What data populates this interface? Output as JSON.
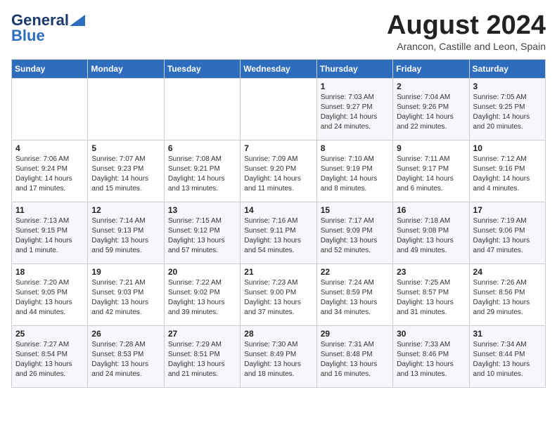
{
  "logo": {
    "line1": "General",
    "line2": "Blue"
  },
  "title": "August 2024",
  "subtitle": "Arancon, Castille and Leon, Spain",
  "headers": [
    "Sunday",
    "Monday",
    "Tuesday",
    "Wednesday",
    "Thursday",
    "Friday",
    "Saturday"
  ],
  "weeks": [
    [
      {
        "day": "",
        "info": ""
      },
      {
        "day": "",
        "info": ""
      },
      {
        "day": "",
        "info": ""
      },
      {
        "day": "",
        "info": ""
      },
      {
        "day": "1",
        "info": "Sunrise: 7:03 AM\nSunset: 9:27 PM\nDaylight: 14 hours\nand 24 minutes."
      },
      {
        "day": "2",
        "info": "Sunrise: 7:04 AM\nSunset: 9:26 PM\nDaylight: 14 hours\nand 22 minutes."
      },
      {
        "day": "3",
        "info": "Sunrise: 7:05 AM\nSunset: 9:25 PM\nDaylight: 14 hours\nand 20 minutes."
      }
    ],
    [
      {
        "day": "4",
        "info": "Sunrise: 7:06 AM\nSunset: 9:24 PM\nDaylight: 14 hours\nand 17 minutes."
      },
      {
        "day": "5",
        "info": "Sunrise: 7:07 AM\nSunset: 9:23 PM\nDaylight: 14 hours\nand 15 minutes."
      },
      {
        "day": "6",
        "info": "Sunrise: 7:08 AM\nSunset: 9:21 PM\nDaylight: 14 hours\nand 13 minutes."
      },
      {
        "day": "7",
        "info": "Sunrise: 7:09 AM\nSunset: 9:20 PM\nDaylight: 14 hours\nand 11 minutes."
      },
      {
        "day": "8",
        "info": "Sunrise: 7:10 AM\nSunset: 9:19 PM\nDaylight: 14 hours\nand 8 minutes."
      },
      {
        "day": "9",
        "info": "Sunrise: 7:11 AM\nSunset: 9:17 PM\nDaylight: 14 hours\nand 6 minutes."
      },
      {
        "day": "10",
        "info": "Sunrise: 7:12 AM\nSunset: 9:16 PM\nDaylight: 14 hours\nand 4 minutes."
      }
    ],
    [
      {
        "day": "11",
        "info": "Sunrise: 7:13 AM\nSunset: 9:15 PM\nDaylight: 14 hours\nand 1 minute."
      },
      {
        "day": "12",
        "info": "Sunrise: 7:14 AM\nSunset: 9:13 PM\nDaylight: 13 hours\nand 59 minutes."
      },
      {
        "day": "13",
        "info": "Sunrise: 7:15 AM\nSunset: 9:12 PM\nDaylight: 13 hours\nand 57 minutes."
      },
      {
        "day": "14",
        "info": "Sunrise: 7:16 AM\nSunset: 9:11 PM\nDaylight: 13 hours\nand 54 minutes."
      },
      {
        "day": "15",
        "info": "Sunrise: 7:17 AM\nSunset: 9:09 PM\nDaylight: 13 hours\nand 52 minutes."
      },
      {
        "day": "16",
        "info": "Sunrise: 7:18 AM\nSunset: 9:08 PM\nDaylight: 13 hours\nand 49 minutes."
      },
      {
        "day": "17",
        "info": "Sunrise: 7:19 AM\nSunset: 9:06 PM\nDaylight: 13 hours\nand 47 minutes."
      }
    ],
    [
      {
        "day": "18",
        "info": "Sunrise: 7:20 AM\nSunset: 9:05 PM\nDaylight: 13 hours\nand 44 minutes."
      },
      {
        "day": "19",
        "info": "Sunrise: 7:21 AM\nSunset: 9:03 PM\nDaylight: 13 hours\nand 42 minutes."
      },
      {
        "day": "20",
        "info": "Sunrise: 7:22 AM\nSunset: 9:02 PM\nDaylight: 13 hours\nand 39 minutes."
      },
      {
        "day": "21",
        "info": "Sunrise: 7:23 AM\nSunset: 9:00 PM\nDaylight: 13 hours\nand 37 minutes."
      },
      {
        "day": "22",
        "info": "Sunrise: 7:24 AM\nSunset: 8:59 PM\nDaylight: 13 hours\nand 34 minutes."
      },
      {
        "day": "23",
        "info": "Sunrise: 7:25 AM\nSunset: 8:57 PM\nDaylight: 13 hours\nand 31 minutes."
      },
      {
        "day": "24",
        "info": "Sunrise: 7:26 AM\nSunset: 8:56 PM\nDaylight: 13 hours\nand 29 minutes."
      }
    ],
    [
      {
        "day": "25",
        "info": "Sunrise: 7:27 AM\nSunset: 8:54 PM\nDaylight: 13 hours\nand 26 minutes."
      },
      {
        "day": "26",
        "info": "Sunrise: 7:28 AM\nSunset: 8:53 PM\nDaylight: 13 hours\nand 24 minutes."
      },
      {
        "day": "27",
        "info": "Sunrise: 7:29 AM\nSunset: 8:51 PM\nDaylight: 13 hours\nand 21 minutes."
      },
      {
        "day": "28",
        "info": "Sunrise: 7:30 AM\nSunset: 8:49 PM\nDaylight: 13 hours\nand 18 minutes."
      },
      {
        "day": "29",
        "info": "Sunrise: 7:31 AM\nSunset: 8:48 PM\nDaylight: 13 hours\nand 16 minutes."
      },
      {
        "day": "30",
        "info": "Sunrise: 7:33 AM\nSunset: 8:46 PM\nDaylight: 13 hours\nand 13 minutes."
      },
      {
        "day": "31",
        "info": "Sunrise: 7:34 AM\nSunset: 8:44 PM\nDaylight: 13 hours\nand 10 minutes."
      }
    ]
  ]
}
